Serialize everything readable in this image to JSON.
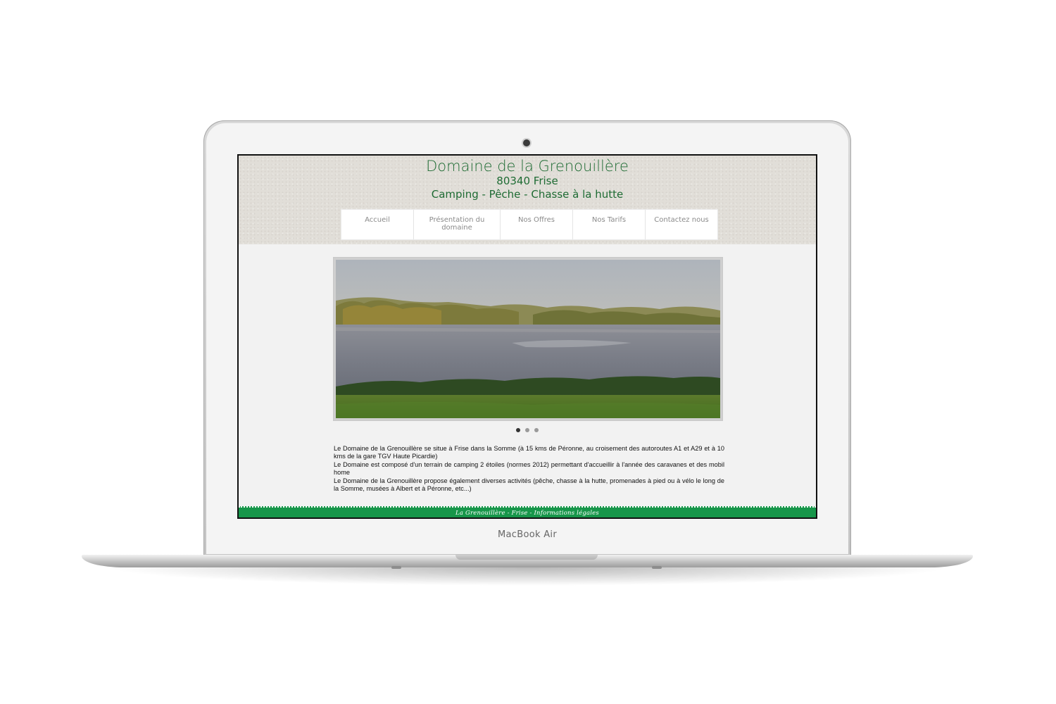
{
  "device": {
    "brand_label": "MacBook Air"
  },
  "site": {
    "title": "Domaine de la Grenouillère",
    "subtitle": "80340 Frise",
    "tagline": "Camping - Pêche - Chasse à la hutte",
    "nav": [
      {
        "label": "Accueil"
      },
      {
        "label": "Présentation du domaine"
      },
      {
        "label": "Nos Offres"
      },
      {
        "label": "Nos Tarifs"
      },
      {
        "label": "Contactez nous"
      }
    ],
    "slider": {
      "slide_count": 3,
      "active_slide": 1
    },
    "intro": {
      "paragraphs": [
        "Le Domaine de la Grenouillère se situe à Frise dans la Somme (à 15 kms de Péronne, au croisement des autoroutes A1 et A29 et à 10 kms de la gare TGV Haute Picardie)",
        "Le Domaine est composé d'un terrain de camping 2 étoiles (normes 2012) permettant d'accueillir à l'année des caravanes et des mobil home",
        "Le Domaine de la Grenouillère propose également diverses activités (pêche, chasse à la hutte, promenades à pied ou à vélo le long de la Somme, musées à Albert et à Péronne, etc...)"
      ]
    },
    "footer": {
      "text": "La Grenouillère - Frise - Informations légales"
    }
  },
  "colors": {
    "title_green": "#1e6b33",
    "footer_green": "#17964a",
    "header_bg": "#e1ded8",
    "page_bg": "#f2f2f2"
  }
}
